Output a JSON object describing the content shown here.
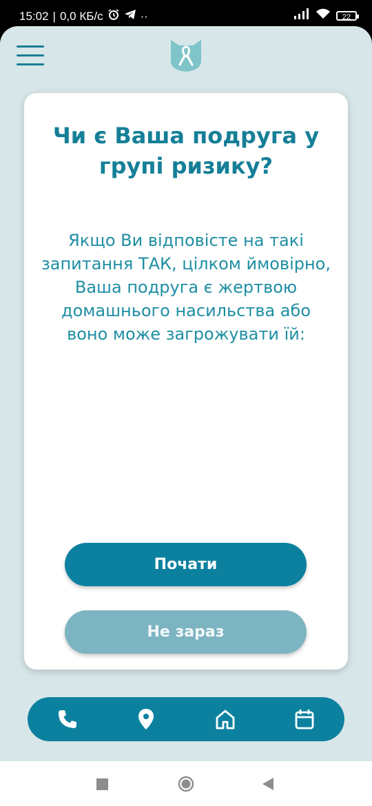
{
  "status_bar": {
    "time": "15:02",
    "network_speed": "0,0 КБ/с",
    "battery": "22",
    "icons": [
      "alarm-icon",
      "telegram-icon",
      "more-dots-icon",
      "signal-icon",
      "wifi-icon",
      "battery-icon"
    ]
  },
  "header": {
    "menu_icon": "hamburger-menu-icon",
    "logo_icon": "cat-ribbon-logo"
  },
  "card": {
    "title": "Чи є Ваша подруга у групі ризику?",
    "description": "Якщо Ви відповісте на такі запитання ТАК, цілком ймовірно, Ваша подруга є жертвою домашнього насильства або воно може загрожувати їй:",
    "start_button": "Почати",
    "later_button": "Не зараз"
  },
  "bottom_nav": {
    "items": [
      "phone-icon",
      "location-pin-icon",
      "home-icon",
      "calendar-icon"
    ]
  },
  "system_nav": {
    "buttons": [
      "recents-square-icon",
      "home-circle-icon",
      "back-triangle-icon"
    ]
  },
  "colors": {
    "background": "#d7e6e8",
    "primary": "#0c819f",
    "primary_light": "#7db4c1",
    "title": "#157f97"
  }
}
